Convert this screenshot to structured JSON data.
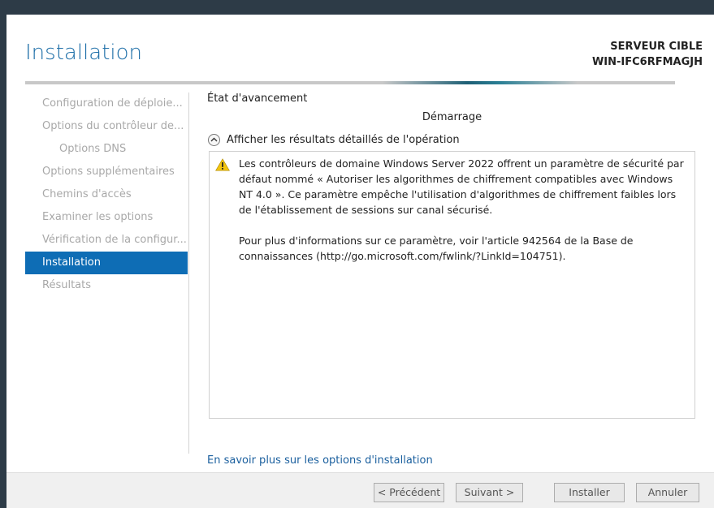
{
  "header": {
    "title": "Installation",
    "target_label": "SERVEUR CIBLE",
    "target_name": "WIN-IFC6RFMAGJH"
  },
  "sidebar": {
    "items": [
      {
        "label": "Configuration de déploie...",
        "state": "disabled"
      },
      {
        "label": "Options du contrôleur de...",
        "state": "disabled"
      },
      {
        "label": "Options DNS",
        "state": "disabled",
        "sub": true
      },
      {
        "label": "Options supplémentaires",
        "state": "disabled"
      },
      {
        "label": "Chemins d'accès",
        "state": "disabled"
      },
      {
        "label": "Examiner les options",
        "state": "disabled"
      },
      {
        "label": "Vérification de la configur...",
        "state": "disabled"
      },
      {
        "label": "Installation",
        "state": "active"
      },
      {
        "label": "Résultats",
        "state": "disabled"
      }
    ]
  },
  "main": {
    "section_label": "État d'avancement",
    "status": "Démarrage",
    "details_toggle_label": "Afficher les résultats détaillés de l'opération",
    "message_paragraph_1": "Les contrôleurs de domaine Windows Server 2022 offrent un paramètre de sécurité par défaut nommé « Autoriser les algorithmes de chiffrement compatibles avec Windows NT 4.0 ». Ce paramètre empêche l'utilisation d'algorithmes de chiffrement faibles lors de l'établissement de sessions sur canal sécurisé.",
    "message_paragraph_2": "Pour plus d'informations sur ce paramètre, voir l'article 942564 de la Base de connaissances (http://go.microsoft.com/fwlink/?LinkId=104751).",
    "learn_more_link": "En savoir plus sur les options d'installation"
  },
  "footer": {
    "previous_label": "< Précédent",
    "next_label": "Suivant >",
    "install_label": "Installer",
    "cancel_label": "Annuler"
  },
  "colors": {
    "accent": "#0e6db5",
    "title": "#1e6fa8",
    "link": "#1a5f9e",
    "warning": "#f2c40f"
  },
  "icons": {
    "toggle": "chevron-up-icon",
    "message": "warning-icon"
  }
}
